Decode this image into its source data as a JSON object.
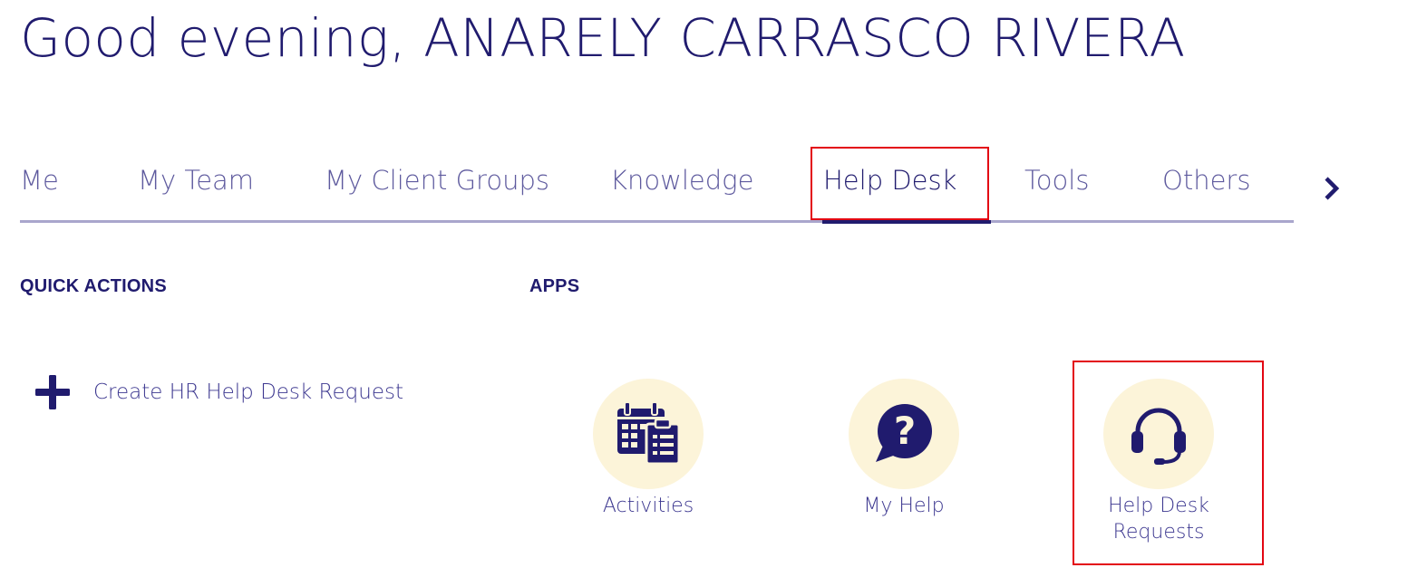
{
  "greeting": "Good evening, ANARELY CARRASCO RIVERA",
  "tabs": [
    {
      "label": "Me"
    },
    {
      "label": "My Team"
    },
    {
      "label": "My Client Groups"
    },
    {
      "label": "Knowledge"
    },
    {
      "label": "Help Desk",
      "active": true
    },
    {
      "label": "Tools"
    },
    {
      "label": "Others"
    }
  ],
  "sections": {
    "quick_actions_heading": "QUICK ACTIONS",
    "apps_heading": "APPS"
  },
  "quick_actions": [
    {
      "label": "Create HR Help Desk Request",
      "icon": "plus-icon"
    }
  ],
  "apps": [
    {
      "label": "Activities",
      "icon": "calendar-clipboard-icon"
    },
    {
      "label": "My Help",
      "icon": "question-bubble-icon"
    },
    {
      "label": "Help Desk Requests",
      "icon": "headset-icon"
    }
  ],
  "colors": {
    "primary": "#201b6e",
    "tab_inactive": "#5e5a9e",
    "tab_baseline": "#a9a6cc",
    "app_circle": "#fcf4d9",
    "highlight": "#e30613"
  }
}
